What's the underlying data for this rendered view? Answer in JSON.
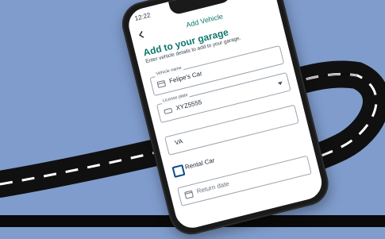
{
  "status_bar": {
    "time": "12:22"
  },
  "header": {
    "title": "Add Vehicle"
  },
  "form": {
    "heading": "Add to your garage",
    "subtitle": "Enter vehicle details to add to your garage.",
    "vehicle_name": {
      "label": "Vehicle name",
      "value": "Felipe's Car"
    },
    "license_plate": {
      "label": "License plate",
      "value": "XYZ5555"
    },
    "state": {
      "value": "VA"
    },
    "rental": {
      "label": "Rental Car"
    },
    "return_date": {
      "placeholder": "Return date"
    }
  }
}
